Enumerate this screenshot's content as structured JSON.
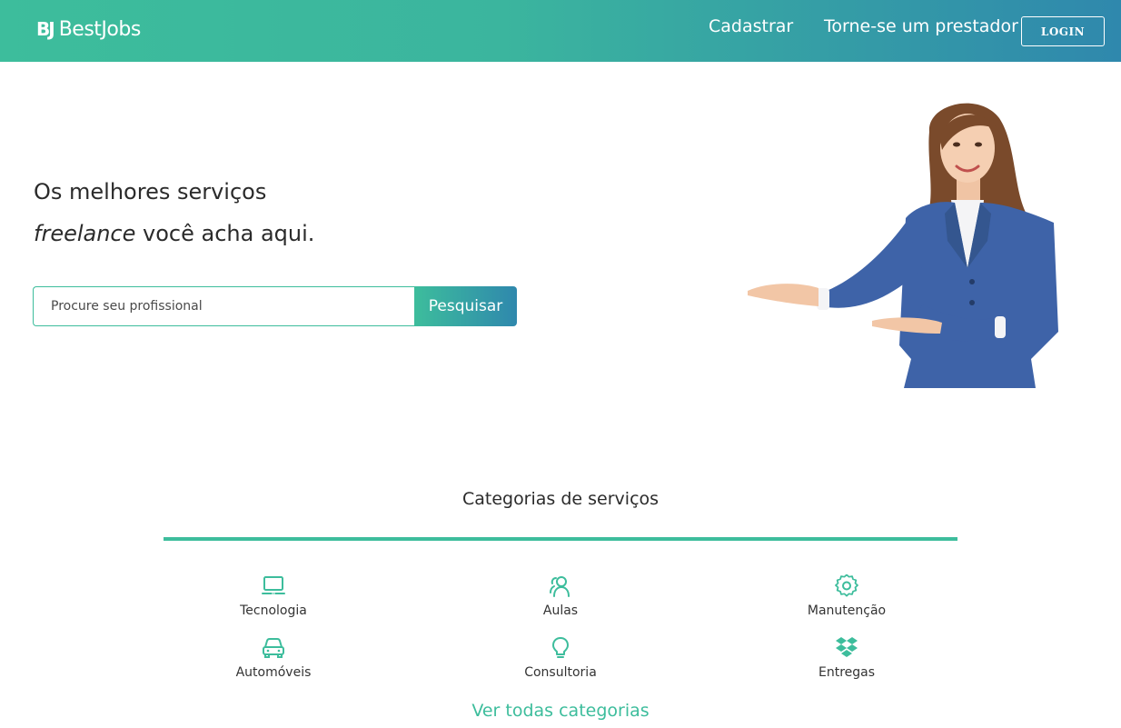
{
  "header": {
    "brand_mark": "BJ",
    "brand_name": "BestJobs",
    "nav_cadastrar": "Cadastrar",
    "nav_prestador": "Torne-se um prestador",
    "login_label": "LOGIN"
  },
  "hero": {
    "headline_line1": "Os melhores serviços",
    "headline_italic": "freelance",
    "headline_line2_rest": " você acha aqui.",
    "search_placeholder": "Procure seu profissional",
    "search_button": "Pesquisar"
  },
  "categories": {
    "title": "Categorias de serviços",
    "items": [
      {
        "label": "Tecnologia",
        "icon": "laptop-icon"
      },
      {
        "label": "Aulas",
        "icon": "users-icon"
      },
      {
        "label": "Manutenção",
        "icon": "gear-icon"
      },
      {
        "label": "Automóveis",
        "icon": "car-icon"
      },
      {
        "label": "Consultoria",
        "icon": "lightbulb-icon"
      },
      {
        "label": "Entregas",
        "icon": "dropbox-icon"
      }
    ],
    "see_all": "Ver todas categorias"
  },
  "colors": {
    "accent": "#3dbd9c",
    "accent_dark": "#2f88ad"
  }
}
